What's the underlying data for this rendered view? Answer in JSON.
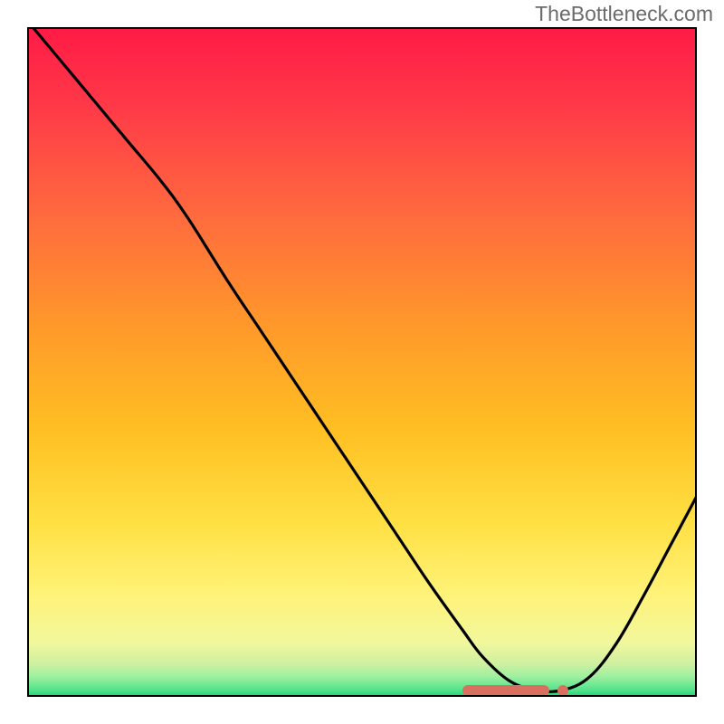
{
  "watermark": "TheBottleneck.com",
  "colors": {
    "gradient_top": "#ff1a46",
    "gradient_bottom": "#17d371",
    "curve": "#000000",
    "marker": "#d9705f"
  },
  "chart_data": {
    "type": "line",
    "title": "",
    "xlabel": "",
    "ylabel": "",
    "xlim": [
      0,
      100
    ],
    "ylim": [
      0,
      100
    ],
    "x": [
      0,
      5,
      10,
      15,
      20,
      24,
      30,
      35,
      40,
      45,
      50,
      55,
      60,
      65,
      68,
      72,
      76,
      80,
      84,
      88,
      92,
      96,
      100
    ],
    "values": [
      101,
      95,
      89,
      83,
      77,
      71.5,
      62,
      54.5,
      47,
      39.5,
      32,
      24.5,
      17,
      10,
      6,
      2.4,
      1.0,
      1.0,
      3,
      8,
      15,
      22.5,
      30
    ],
    "optimal_marker": {
      "band_start_x": 65,
      "band_end_x": 78,
      "dot_x": 80,
      "y": 1.0
    }
  }
}
